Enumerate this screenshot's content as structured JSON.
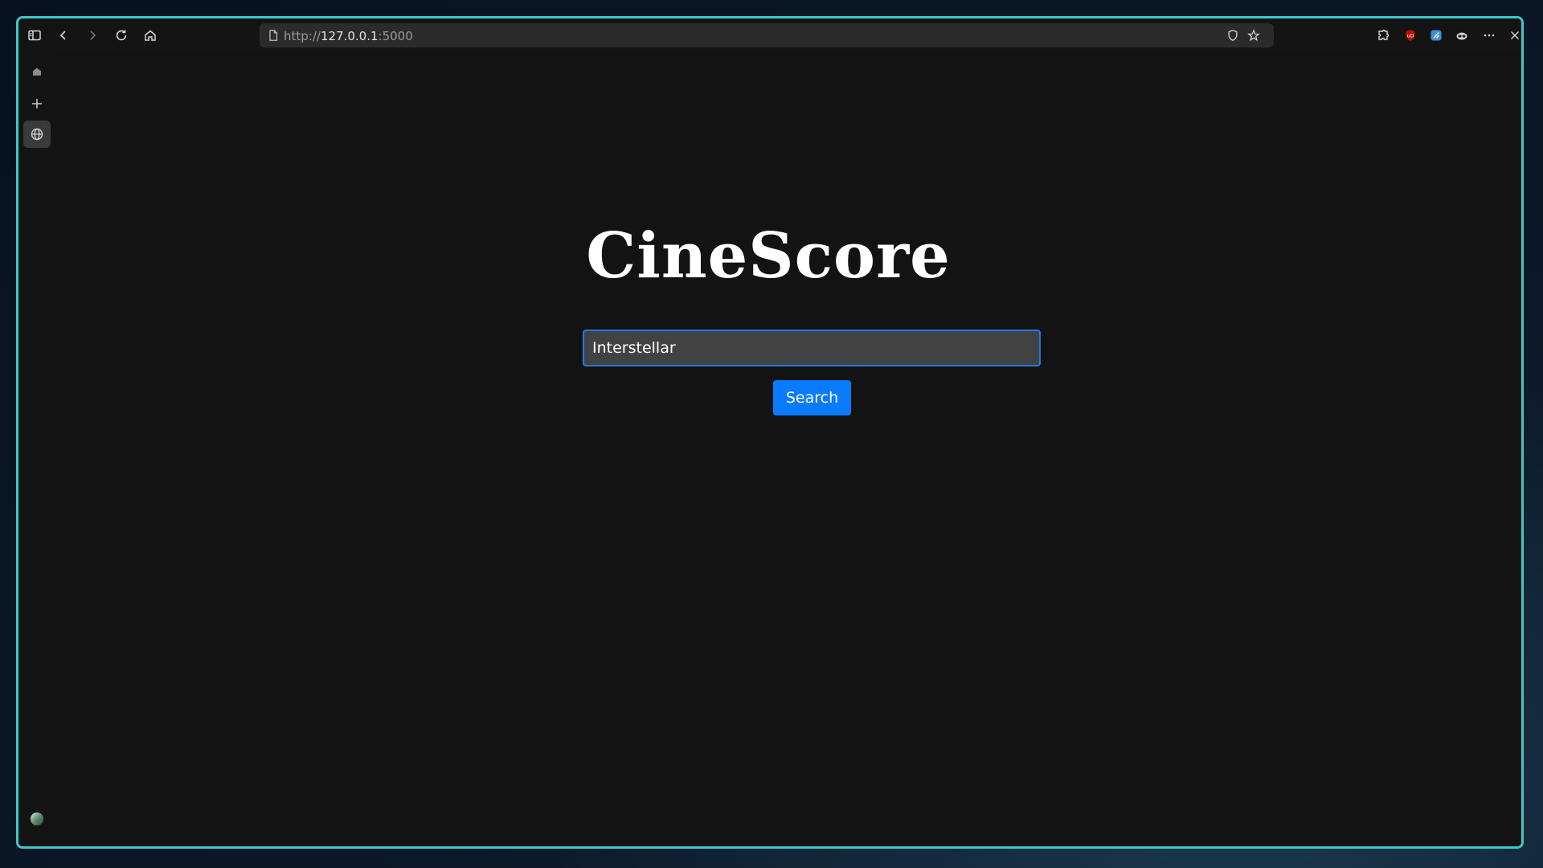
{
  "browser": {
    "url_scheme": "http://",
    "url_host": "127.0.0.1",
    "url_port": ":5000",
    "toolbar_icons": [
      "sidebar-toggle-icon",
      "back-arrow-icon",
      "forward-arrow-icon",
      "reload-icon",
      "home-icon",
      "page-icon",
      "shield-icon",
      "star-icon",
      "extensions-icon",
      "ublock-icon",
      "bitwarden-icon",
      "privacy-badger-icon",
      "more-icon",
      "close-icon"
    ],
    "sidebar_icons": [
      "home-icon",
      "new-tab-icon",
      "globe-icon",
      "profile-avatar-icon",
      "downloads-icon"
    ]
  },
  "page": {
    "title": "CineScore",
    "search_value": "Interstellar",
    "search_button_label": "Search"
  },
  "colors": {
    "window_border": "#3fc7c9",
    "button_blue": "#0a7bff",
    "input_border": "#1f7ae0",
    "background": "#131313"
  }
}
